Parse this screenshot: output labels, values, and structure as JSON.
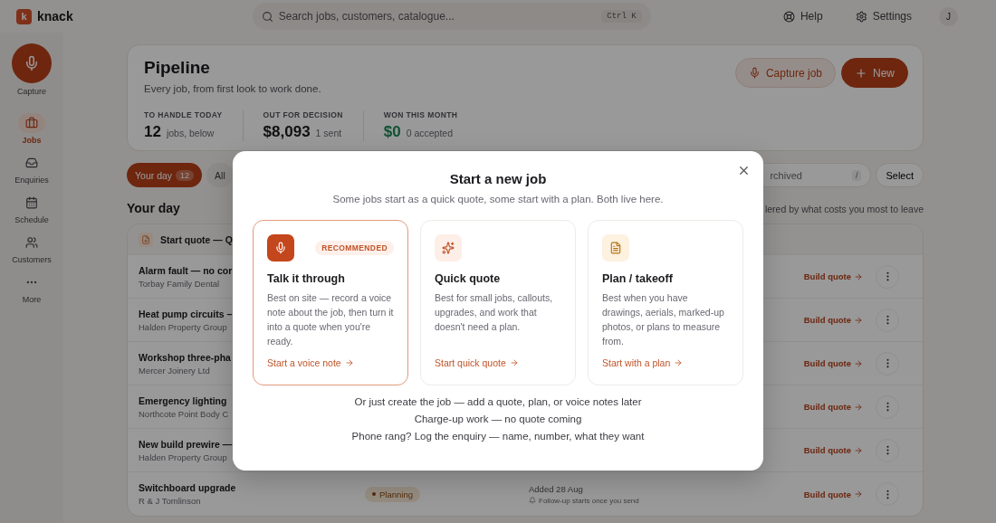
{
  "app": {
    "logo_letter": "k",
    "name": "knack"
  },
  "search": {
    "placeholder": "Search jobs, customers, catalogue...",
    "shortcut": "Ctrl K"
  },
  "top_actions": [
    {
      "label": "Help",
      "kind": "help"
    },
    {
      "label": "Settings",
      "kind": "settings"
    }
  ],
  "avatar": "J",
  "sidebar": {
    "items": [
      {
        "label": "Capture",
        "kind": "capture",
        "selected": false
      },
      {
        "label": "Jobs",
        "kind": "jobs",
        "selected": true
      },
      {
        "label": "Enquiries",
        "kind": "enquiries",
        "selected": false
      },
      {
        "label": "Schedule",
        "kind": "schedule",
        "selected": false
      },
      {
        "label": "Customers",
        "kind": "customers",
        "selected": false
      },
      {
        "label": "More",
        "kind": "more",
        "selected": false
      }
    ]
  },
  "pipeline": {
    "title": "Pipeline",
    "subtitle": "Every job, from first look to work done.",
    "stats": [
      {
        "label": "TO HANDLE TODAY",
        "value": "12",
        "note": "jobs, below",
        "positive": false
      },
      {
        "label": "OUT FOR DECISION",
        "value": "$8,093",
        "note": "1 sent",
        "positive": false
      },
      {
        "label": "WON THIS MONTH",
        "value": "$0",
        "note": "0 accepted",
        "positive": true
      }
    ],
    "actions": [
      {
        "label": "Capture job",
        "kind": "secondary"
      },
      {
        "label": "New",
        "kind": "primary"
      }
    ]
  },
  "tabs": [
    {
      "label": "Your day",
      "count": "12",
      "selected": true
    },
    {
      "label": "All",
      "selected": false
    }
  ],
  "filter": {
    "placeholder": "rchived",
    "shortcut": "/"
  },
  "select_button": "Select",
  "section": {
    "title": "Your day",
    "note": "lered by what costs you most to leave"
  },
  "group": {
    "title": "Start quote — Q"
  },
  "rows": [
    {
      "title": "Alarm fault — no cor",
      "customer": "Torbay Family Dental",
      "action": "Build quote"
    },
    {
      "title": "Heat pump circuits –",
      "customer": "Halden Property Group",
      "action": "Build quote"
    },
    {
      "title": "Workshop three-pha",
      "customer": "Mercer Joinery Ltd",
      "action": "Build quote"
    },
    {
      "title": "Emergency lighting",
      "customer": "Northcote Point Body C",
      "action": "Build quote"
    },
    {
      "title": "New build prewire —",
      "customer": "Halden Property Group",
      "action": "Build quote"
    },
    {
      "title": "Switchboard upgrade",
      "customer": "R & J Tomlinson",
      "status": "Planning",
      "added": "Added 28 Aug",
      "followup": "Follow-up starts once you send",
      "action": "Build quote"
    }
  ],
  "modal": {
    "title": "Start a new job",
    "subtitle": "Some jobs start as a quick quote, some start with a plan. Both live here.",
    "options": [
      {
        "kind": "voice",
        "selected": true,
        "badge": "RECOMMENDED",
        "title": "Talk it through",
        "description": "Best on site — record a voice note about the job, then turn it into a quote when you're ready.",
        "link": "Start a voice note"
      },
      {
        "kind": "quick",
        "selected": false,
        "title": "Quick quote",
        "description": "Best for small jobs, callouts, upgrades, and work that doesn't need a plan.",
        "link": "Start quick quote"
      },
      {
        "kind": "plan",
        "selected": false,
        "title": "Plan / takeoff",
        "description": "Best when you have drawings, aerials, marked-up photos, or plans to measure from.",
        "link": "Start with a plan"
      }
    ],
    "links": [
      "Or just create the job — add a quote, plan, or voice notes later",
      "Charge-up work — no quote coming",
      "Phone rang? Log the enquiry — name, number, what they want"
    ]
  }
}
